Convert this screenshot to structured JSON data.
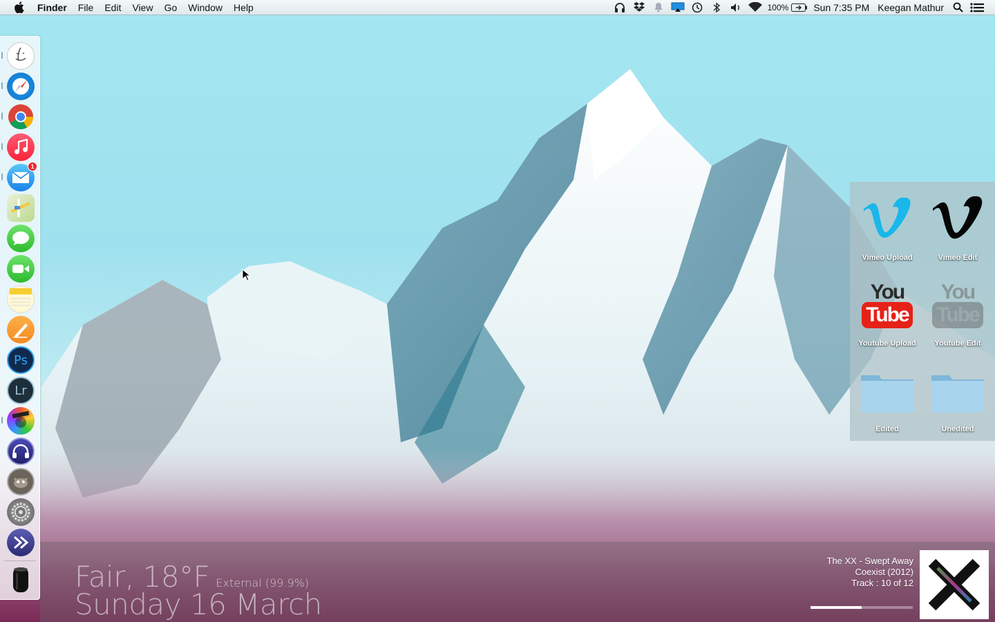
{
  "menubar": {
    "app_name": "Finder",
    "menus": [
      "File",
      "Edit",
      "View",
      "Go",
      "Window",
      "Help"
    ],
    "battery_percent": "100%",
    "clock": "Sun 7:35 PM",
    "user_name": "Keegan Mathur",
    "status_icons": [
      "headphones-icon",
      "dropbox-icon",
      "notification-bell-icon",
      "airplay-icon",
      "time-machine-icon",
      "bluetooth-icon",
      "volume-icon",
      "wifi-icon",
      "battery-icon"
    ]
  },
  "dock": {
    "items": [
      {
        "name": "finder",
        "icon": "finder-icon",
        "running": true
      },
      {
        "name": "safari",
        "icon": "safari-icon",
        "running": true
      },
      {
        "name": "chrome",
        "icon": "chrome-icon",
        "running": true
      },
      {
        "name": "itunes",
        "icon": "itunes-icon",
        "running": true
      },
      {
        "name": "mail",
        "icon": "mail-icon",
        "running": true,
        "badge": "1"
      },
      {
        "name": "maps",
        "icon": "maps-icon",
        "running": false
      },
      {
        "name": "messages",
        "icon": "messages-icon",
        "running": false
      },
      {
        "name": "facetime",
        "icon": "facetime-icon",
        "running": false
      },
      {
        "name": "notes",
        "icon": "notes-icon",
        "running": false
      },
      {
        "name": "pages",
        "icon": "pages-icon",
        "running": false
      },
      {
        "name": "photoshop",
        "icon": "photoshop-icon",
        "running": false
      },
      {
        "name": "lightroom",
        "icon": "lightroom-icon",
        "running": false
      },
      {
        "name": "final-cut",
        "icon": "final-cut-icon",
        "running": true
      },
      {
        "name": "audio-app",
        "icon": "headphones-app-icon",
        "running": false
      },
      {
        "name": "gimp",
        "icon": "gimp-icon",
        "running": false
      },
      {
        "name": "system-preferences",
        "icon": "gear-icon",
        "running": false
      },
      {
        "name": "quicksilver",
        "icon": "chevron-app-icon",
        "running": false
      },
      {
        "name": "trash",
        "icon": "trash-icon",
        "running": false
      }
    ]
  },
  "shortcuts": [
    {
      "label": "Vimeo Upload",
      "icon": "vimeo-blue-icon"
    },
    {
      "label": "Vimeo Edit",
      "icon": "vimeo-black-icon"
    },
    {
      "label": "Youtube Upload",
      "icon": "youtube-red-icon"
    },
    {
      "label": "Youtube Edit",
      "icon": "youtube-gray-icon"
    },
    {
      "label": "Edited",
      "icon": "folder-icon"
    },
    {
      "label": "Unedited",
      "icon": "folder-icon"
    }
  ],
  "youtube_logo": {
    "you": "You",
    "tube": "Tube"
  },
  "weather": {
    "condition": "Fair, 18°F",
    "source": "External (99.9%)",
    "date": "Sunday 16 March"
  },
  "now_playing": {
    "title_line": "The XX - Swept Away",
    "album_line": "Coexist (2012)",
    "track_line": "Track : 10 of 12",
    "progress_fraction": 0.5
  },
  "colors": {
    "sky": "#a3e7f1",
    "panel": "#afc3c8",
    "vimeo_blue": "#1ab7ea",
    "youtube_red": "#e62117",
    "folder_blue": "#9fcce8"
  }
}
